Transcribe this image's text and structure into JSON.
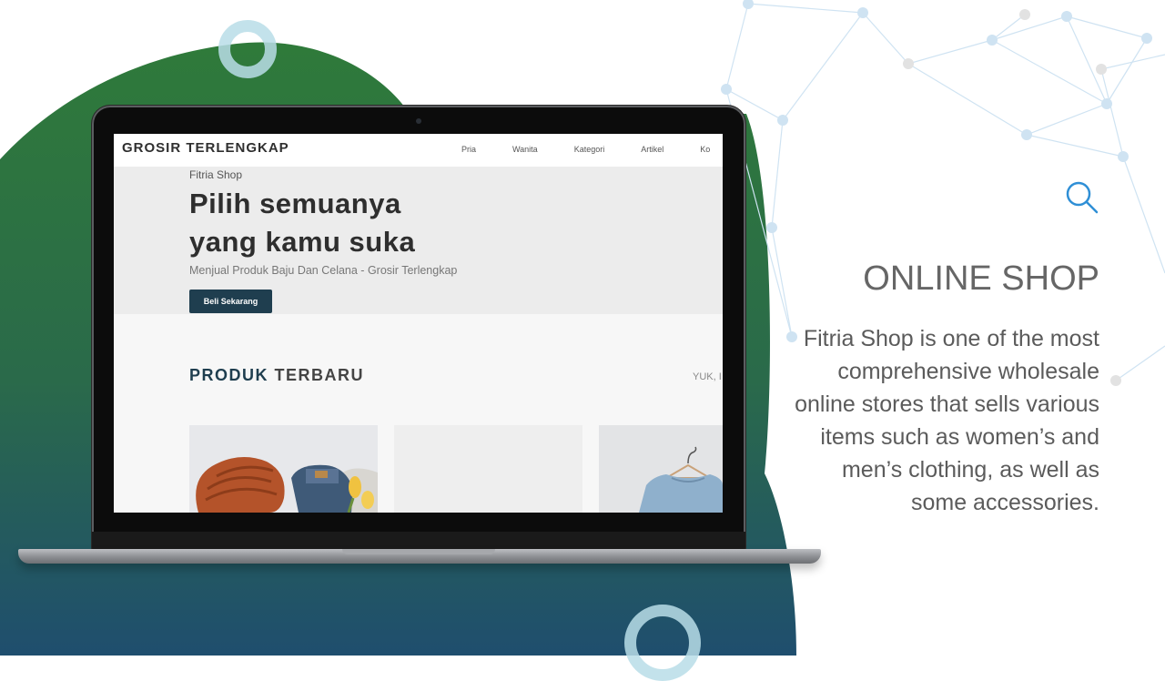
{
  "colors": {
    "blob_top": "#2f7a3a",
    "blob_bottom": "#1f4e6e",
    "ring": "#b9dde8",
    "hero_button": "#1f3e4f",
    "section_accent": "#1f3e4f"
  },
  "laptop": {
    "site": {
      "brand": "GROSIR TERLENGKAP",
      "nav_items": [
        "Pria",
        "Wanita",
        "Kategori",
        "Artikel",
        "Ko"
      ],
      "hero_kicker": "Fitria Shop",
      "hero_title_line1": "Pilih semuanya",
      "hero_title_line2": "yang kamu suka",
      "hero_subtitle": "Menjual Produk Baju Dan Celana - Grosir Terlengkap",
      "hero_button": "Beli Sekarang",
      "section_title_a": "PRODUK",
      "section_title_b": "TERBARU",
      "section_side": "YUK, I"
    }
  },
  "panel": {
    "icon": "search-icon",
    "title": "ONLINE SHOP",
    "description": "Fitria Shop is one of the most comprehensive wholesale online stores that sells various items such as women’s and men’s clothing, as well as some accessories."
  }
}
